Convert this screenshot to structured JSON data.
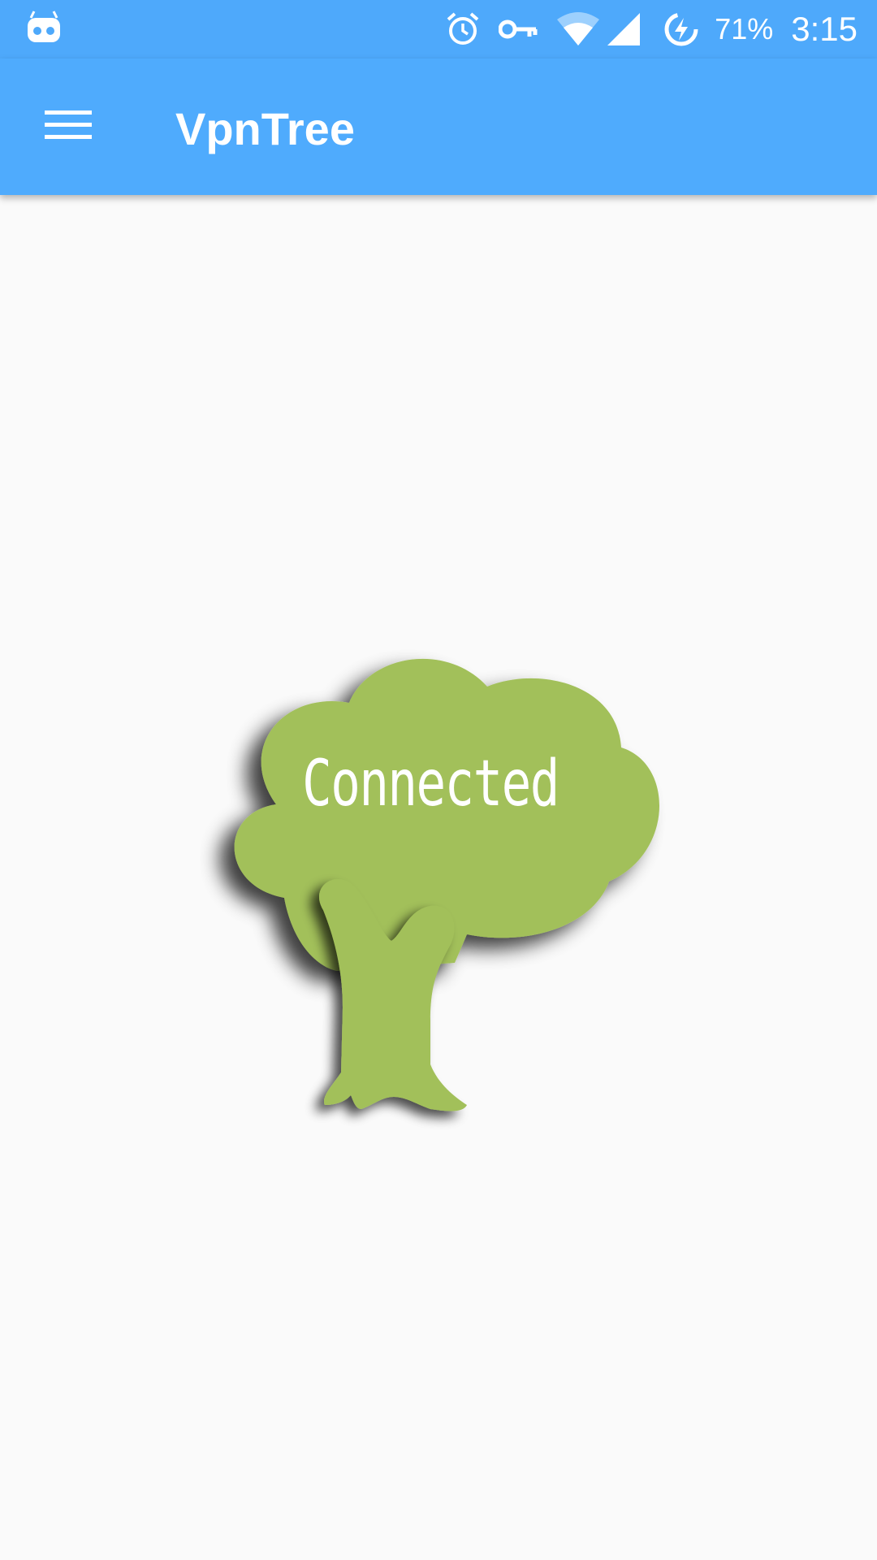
{
  "status_bar": {
    "battery_percent": "71%",
    "time": "3:15",
    "icons": [
      "cyanogen-bot-icon",
      "alarm-icon",
      "vpn-key-icon",
      "wifi-icon",
      "cell-signal-icon",
      "battery-charging-icon"
    ]
  },
  "app_bar": {
    "title": "VpnTree",
    "menu_icon": "hamburger-menu-icon"
  },
  "main": {
    "tree_status": "Connected",
    "tree_icon": "tree-icon"
  },
  "colors": {
    "status_bar": "#4ea9fb",
    "app_bar": "#4fabfd",
    "background": "#fafafa",
    "tree_green": "#a2c05a"
  }
}
